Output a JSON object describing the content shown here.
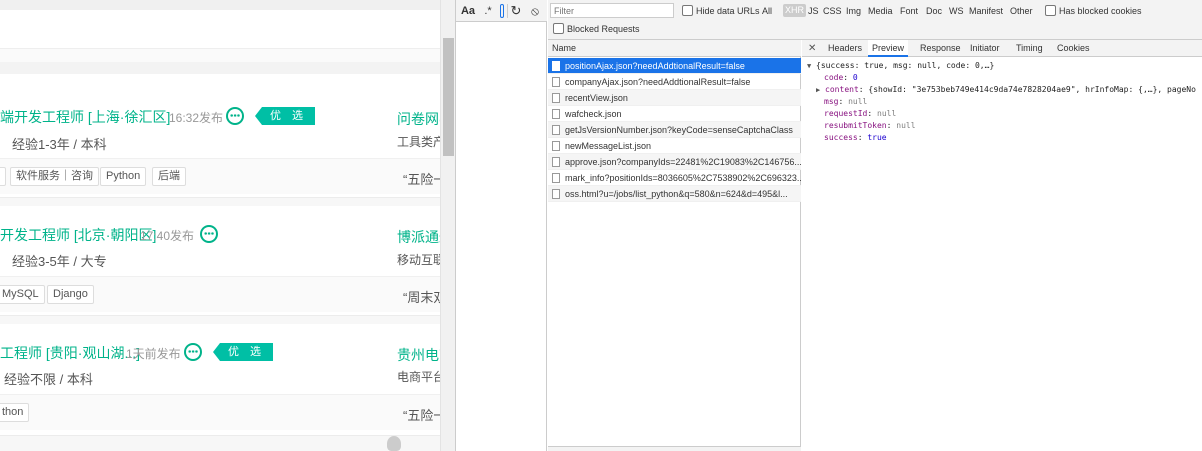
{
  "page": {
    "jobs": [
      {
        "title": "端开发工程师 [上海·徐汇区]",
        "time": "16:32发布",
        "youxuan": "优 选",
        "exp": "经验1-3年 / 本科",
        "company": "问卷网(",
        "industry": "工具类产",
        "tags": [
          "",
          "软件服务｜咨询",
          "Python",
          "后端"
        ],
        "benefit": "“五险一"
      },
      {
        "title": "开发工程师 [北京·朝阳区]",
        "time": "17:40发布",
        "exp": "经验3-5年 / 大专",
        "company": "博派通达",
        "industry": "移动互联",
        "tags": [
          "MySQL",
          "Django"
        ],
        "benefit": "“周末双"
      },
      {
        "title": "工程师 [贵阳·观山湖...]",
        "time": "1天前发布",
        "youxuan": "优 选",
        "exp": "经验不限 / 本科",
        "company": "贵州电商",
        "industry": "电商平台",
        "tags": [
          "thon"
        ],
        "benefit": "“五险一"
      }
    ]
  },
  "devtools": {
    "tools": {
      "font_btn": "Aa",
      "regex_btn": ".*",
      "reload_icon": "↻",
      "block_icon": "⦸"
    },
    "filter": {
      "placeholder": "Filter",
      "hide_data_urls": "Hide data URLs",
      "types": [
        "All",
        "XHR",
        "JS",
        "CSS",
        "Img",
        "Media",
        "Font",
        "Doc",
        "WS",
        "Manifest",
        "Other"
      ],
      "has_blocked_cookies": "Has blocked cookies",
      "blocked_requests": "Blocked Requests"
    },
    "requests": {
      "header": "Name",
      "rows": [
        "positionAjax.json?needAddtionalResult=false",
        "companyAjax.json?needAddtionalResult=false",
        "recentView.json",
        "wafcheck.json",
        "getJsVersionNumber.json?keyCode=senseCaptchaClass",
        "newMessageList.json",
        "approve.json?companyIds=22481%2C19083%2C146756...",
        "mark_info?positionIds=8036605%2C7538902%2C696323...",
        "oss.html?u=/jobs/list_python&q=580&n=624&d=495&l..."
      ]
    },
    "preview": {
      "tabs": [
        "Headers",
        "Preview",
        "Response",
        "Initiator",
        "Timing",
        "Cookies"
      ],
      "summary": "{success: true, msg: null, code: 0,…}",
      "lines": [
        {
          "key": "code",
          "value": "0"
        },
        {
          "key": "content",
          "value": "{showId: \"3e753beb749e414c9da74e7828204ae9\", hrInfoMap: {,…}, pageNo"
        },
        {
          "key": "msg",
          "value": "null"
        },
        {
          "key": "requestId",
          "value": "null"
        },
        {
          "key": "resubmitToken",
          "value": "null"
        },
        {
          "key": "success",
          "value": "true"
        }
      ]
    }
  }
}
